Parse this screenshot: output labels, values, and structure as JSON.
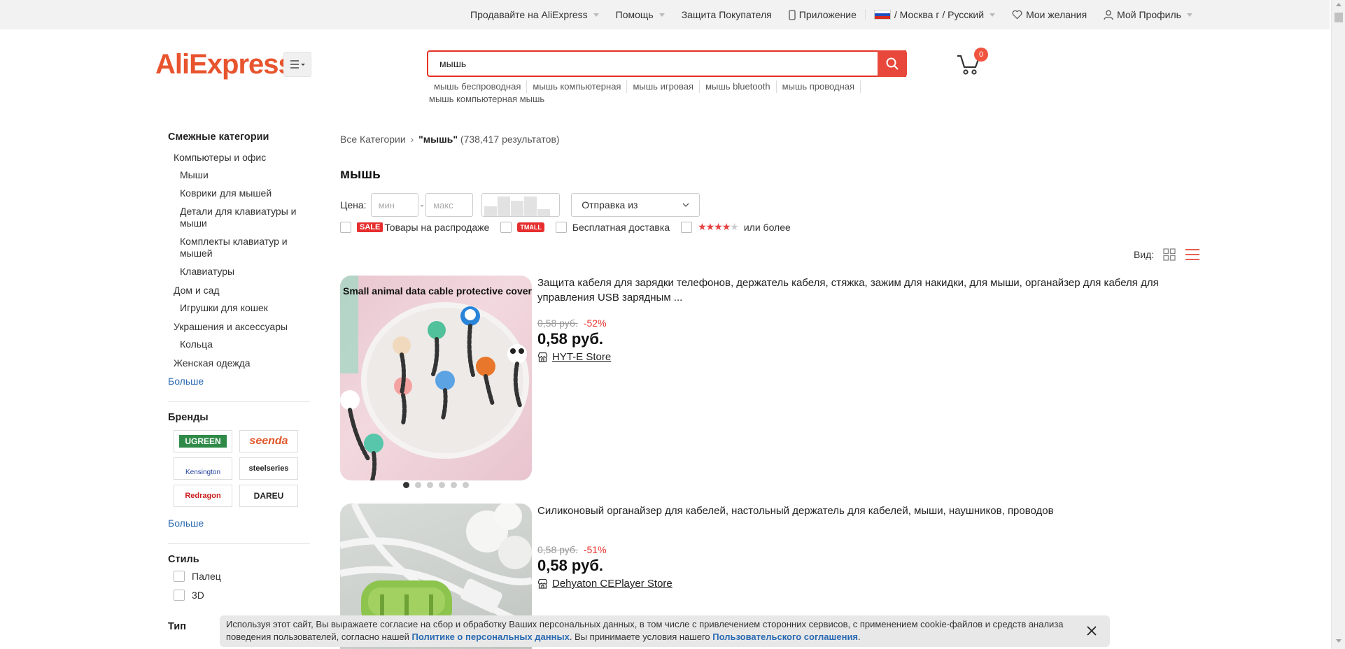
{
  "topbar": {
    "sell": "Продавайте на AliExpress",
    "help": "Помощь",
    "protection": "Защита Покупателя",
    "app": "Приложение",
    "region": "/ Москва г / Русский",
    "wishlist": "Мои желания",
    "profile": "Мой Профиль"
  },
  "header": {
    "logo": "AliExpress",
    "search_value": "мышь",
    "cart_count": "0",
    "suggestions": [
      "мышь беспроводная",
      "мышь компьютерная",
      "мышь игровая",
      "мышь bluetooth",
      "мышь проводная",
      "мышь компьютерная мышь"
    ]
  },
  "sidebar": {
    "related_title": "Смежные категории",
    "categories": [
      {
        "label": "Компьютеры и офис",
        "level": 1
      },
      {
        "label": "Мыши",
        "level": 2
      },
      {
        "label": "Коврики для мышей",
        "level": 2
      },
      {
        "label": "Детали для клавиатуры и мыши",
        "level": 2
      },
      {
        "label": "Комплекты клавиатур и мышей",
        "level": 2
      },
      {
        "label": "Клавиатуры",
        "level": 2
      },
      {
        "label": "Дом и сад",
        "level": 1
      },
      {
        "label": "Игрушки для кошек",
        "level": 2
      },
      {
        "label": "Украшения и аксессуары",
        "level": 1
      },
      {
        "label": "Кольца",
        "level": 2
      },
      {
        "label": "Женская одежда",
        "level": 1
      }
    ],
    "more": "Больше",
    "brands_title": "Бренды",
    "brands": [
      "UGREEN",
      "seenda",
      "Kensington",
      "steelseries",
      "Redragon",
      "DAREU"
    ],
    "brands_more": "Больше",
    "style_title": "Стиль",
    "styles": [
      "Палец",
      "3D"
    ],
    "type_title": "Тип"
  },
  "main": {
    "breadcrumb_root": "Все Категории",
    "breadcrumb_query": "\"мышь\"",
    "breadcrumb_count": "(738,417 результатов)",
    "heading": "мышь",
    "price_label": "Цена:",
    "price_min_placeholder": "мин",
    "price_dash": "-",
    "price_max_placeholder": "макс",
    "ship_from": "Отправка из",
    "sale_badge": "SALE",
    "sale_label": "Товары на распродаже",
    "tmall_badge": "TMALL",
    "free_shipping": "Бесплатная доставка",
    "rating_label": "или более",
    "view_label": "Вид:"
  },
  "products": [
    {
      "title": "Защита кабеля для зарядки телефонов, держатель кабеля, стяжка, зажим для накидки, для мыши, органайзер для кабеля для управления USB зарядным ...",
      "old_price": "0,58 руб.",
      "discount": "-52%",
      "price": "0,58 руб.",
      "store": "HYT-E Store",
      "image_caption": "Small animal data cable protective cover"
    },
    {
      "title": "Силиконовый органайзер для кабелей, настольный держатель для кабелей, мыши, наушников, проводов",
      "old_price": "0,58 руб.",
      "discount": "-51%",
      "price": "0,58 руб.",
      "store": "Dehyaton CEPlayer Store"
    }
  ],
  "cookie": {
    "text1": "Используя этот сайт, Вы выражаете согласие на сбор и обработку Ваших персональных данных, в том числе с привлечением сторонних сервисов, с применением cookie-файлов и средств анализа поведения пользователей, согласно нашей",
    "link1": "Политике о персональных данных",
    "text2": ". Вы принимаете условия нашего",
    "link2": "Пользовательского соглашения",
    "text3": "."
  }
}
